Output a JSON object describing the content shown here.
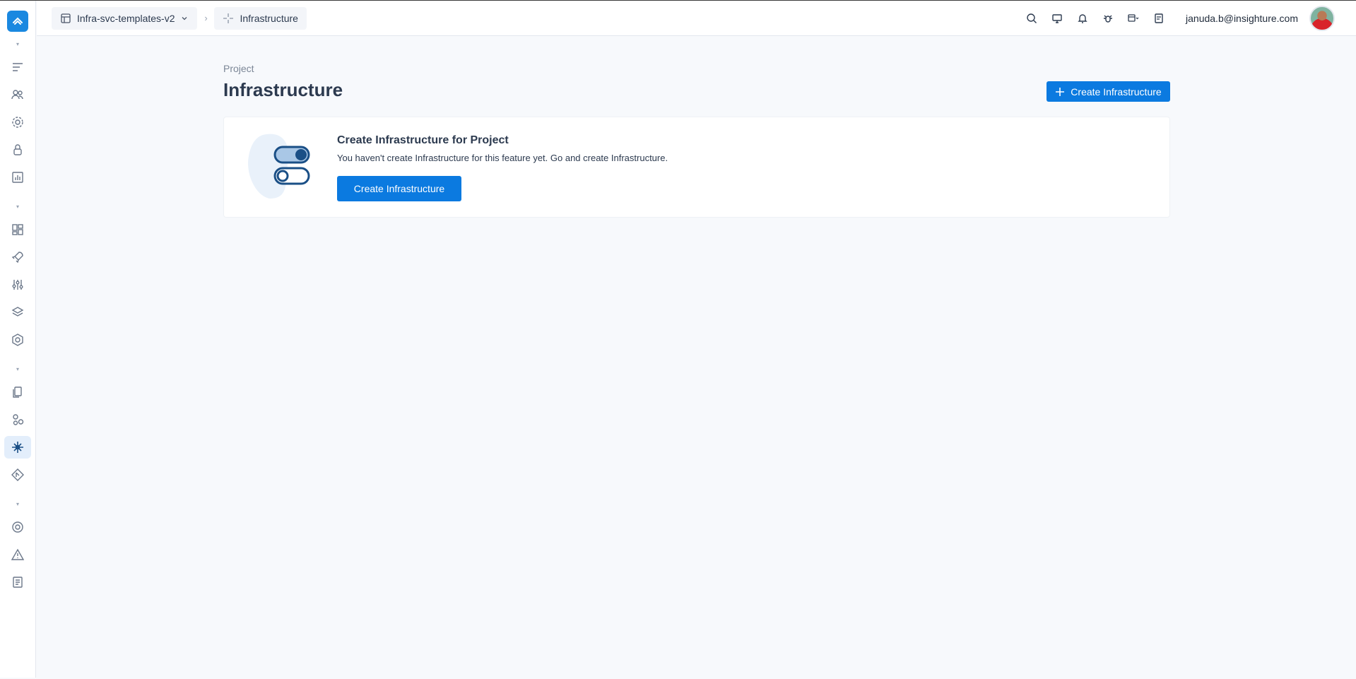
{
  "header": {
    "project_crumb": "Infra-svc-templates-v2",
    "page_crumb": "Infrastructure",
    "user_email": "januda.b@insighture.com"
  },
  "main": {
    "kicker": "Project",
    "title": "Infrastructure",
    "create_button_label": "Create Infrastructure"
  },
  "empty_state": {
    "title": "Create Infrastructure for Project",
    "message": "You haven't create Infrastructure for this feature yet. Go and create Infrastructure.",
    "button_label": "Create Infrastructure"
  },
  "colors": {
    "accent": "#0b7ae0",
    "background": "#f7f9fc",
    "surface": "#ffffff"
  },
  "icons": {
    "sidebar": [
      "list-icon",
      "users-icon",
      "gear-icon",
      "lock-icon",
      "bar-chart-icon",
      "dashboard-icon",
      "rocket-icon",
      "sliders-icon",
      "layers-icon",
      "network-icon",
      "documents-icon",
      "nodes-icon",
      "infrastructure-icon",
      "git-icon",
      "settings-circle-icon",
      "warning-icon",
      "report-icon"
    ],
    "header": [
      "search-icon",
      "monitor-icon",
      "bell-icon",
      "bug-icon",
      "calendar-icon",
      "notes-icon"
    ]
  }
}
